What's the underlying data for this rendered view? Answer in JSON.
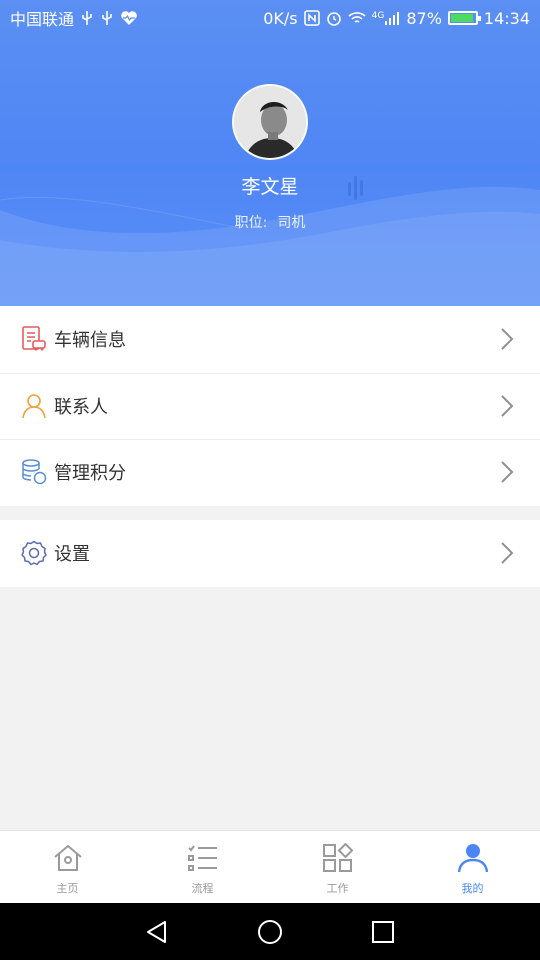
{
  "status_bar": {
    "carrier": "中国联通",
    "speed": "0K/s",
    "network": "4G",
    "battery": "87%",
    "time": "14:34"
  },
  "profile": {
    "name": "李文星",
    "role_label": "职位:",
    "role_value": "司机"
  },
  "menu": {
    "items": [
      {
        "label": "车辆信息",
        "icon": "vehicle-info-icon"
      },
      {
        "label": "联系人",
        "icon": "contact-person-icon"
      },
      {
        "label": "管理积分",
        "icon": "points-database-icon"
      }
    ],
    "settings": {
      "label": "设置",
      "icon": "settings-gear-icon"
    }
  },
  "tabbar": {
    "tabs": [
      {
        "label": "主页",
        "icon": "home-icon"
      },
      {
        "label": "流程",
        "icon": "checklist-icon"
      },
      {
        "label": "工作",
        "icon": "grid-apps-icon"
      },
      {
        "label": "我的",
        "icon": "user-icon"
      }
    ],
    "active_index": 3,
    "active_color": "#4a86f6"
  },
  "colors": {
    "header_blue": "#5b8ff3",
    "accent": "#4a86f6",
    "background": "#f2f2f2"
  }
}
